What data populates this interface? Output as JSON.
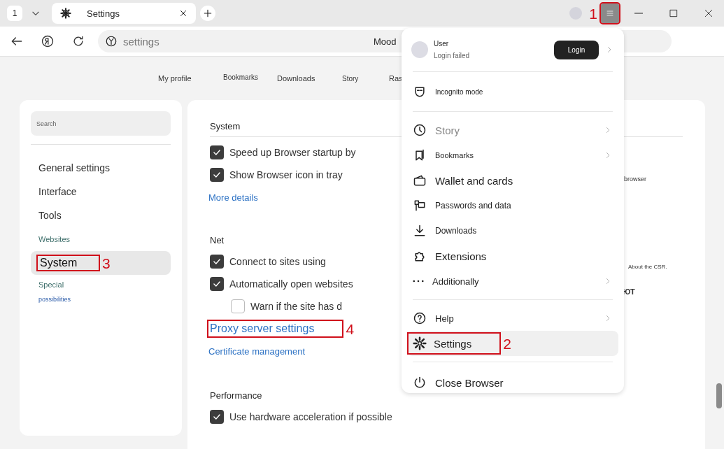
{
  "titlebar": {
    "tab_count": "1",
    "tabs": [
      {
        "title": "Settings",
        "selected": true
      }
    ],
    "menu_button": {
      "annotation": "1"
    }
  },
  "toolbar": {
    "address": "settings",
    "page_title": "Mood"
  },
  "nav_links": [
    {
      "label": "My profile"
    },
    {
      "label": "Bookmarks"
    },
    {
      "label": "Downloads"
    },
    {
      "label": "Story"
    },
    {
      "label": "Ras"
    }
  ],
  "sidebar": {
    "search": {
      "placeholder": "Search"
    },
    "items": [
      {
        "label": "General settings",
        "kind": "main",
        "selected": false
      },
      {
        "label": "Interface",
        "kind": "main",
        "selected": false
      },
      {
        "label": "Tools",
        "kind": "main",
        "selected": false
      },
      {
        "label": "Websites",
        "kind": "sub",
        "selected": false
      },
      {
        "label": "System",
        "kind": "main",
        "selected": true,
        "annotation": "3"
      },
      {
        "label": "Special",
        "kind": "sub",
        "selected": false
      },
      {
        "label": "possibilities",
        "kind": "note",
        "selected": false
      }
    ]
  },
  "sections": [
    {
      "title": "System",
      "items": [
        {
          "kind": "checkbox",
          "label": "Speed up Browser startup by",
          "checked": true
        },
        {
          "kind": "checkbox",
          "label": "Show Browser icon in tray",
          "checked": true
        },
        {
          "kind": "link",
          "label": "More details"
        }
      ]
    },
    {
      "title": "Net",
      "items": [
        {
          "kind": "checkbox",
          "label": "Connect to sites using",
          "checked": true
        },
        {
          "kind": "checkbox",
          "label": "Automatically open websites",
          "checked": true,
          "children": [
            {
              "kind": "checkbox",
              "label": "Warn if the site has d",
              "checked": false
            }
          ]
        },
        {
          "kind": "link",
          "label": "Proxy server settings",
          "annotation": "4"
        },
        {
          "kind": "link",
          "label": "Certificate management"
        }
      ]
    },
    {
      "title": "Performance",
      "items": [
        {
          "kind": "checkbox",
          "label": "Use hardware acceleration if possible",
          "checked": true
        }
      ]
    }
  ],
  "side_fragments": [
    "browser",
    "About the CSR.",
    "ЮТ"
  ],
  "menu": {
    "user": {
      "name": "User",
      "status": "Login failed",
      "submenu": true
    },
    "login_button": "Login",
    "groups": [
      [
        {
          "label": "Incognito mode",
          "submenu": false,
          "disabled": false,
          "selected": false
        }
      ],
      [
        {
          "label": "Story",
          "submenu": true,
          "disabled": true,
          "selected": false
        },
        {
          "label": "Bookmarks",
          "submenu": true,
          "disabled": false,
          "selected": false
        },
        {
          "label": "Wallet and cards",
          "submenu": false,
          "disabled": false,
          "selected": false
        },
        {
          "label": "Passwords and data",
          "submenu": false,
          "disabled": false,
          "selected": false
        },
        {
          "label": "Downloads",
          "submenu": false,
          "disabled": false,
          "selected": false
        },
        {
          "label": "Extensions",
          "submenu": false,
          "disabled": false,
          "selected": false
        },
        {
          "label": "Additionally",
          "submenu": true,
          "disabled": false,
          "selected": false
        }
      ],
      [
        {
          "label": "Help",
          "submenu": true,
          "disabled": false,
          "selected": false
        },
        {
          "label": "Settings",
          "submenu": false,
          "disabled": false,
          "selected": true,
          "annotation": "2"
        }
      ],
      [
        {
          "label": "Close Browser",
          "submenu": false,
          "disabled": false,
          "selected": false
        }
      ]
    ]
  }
}
